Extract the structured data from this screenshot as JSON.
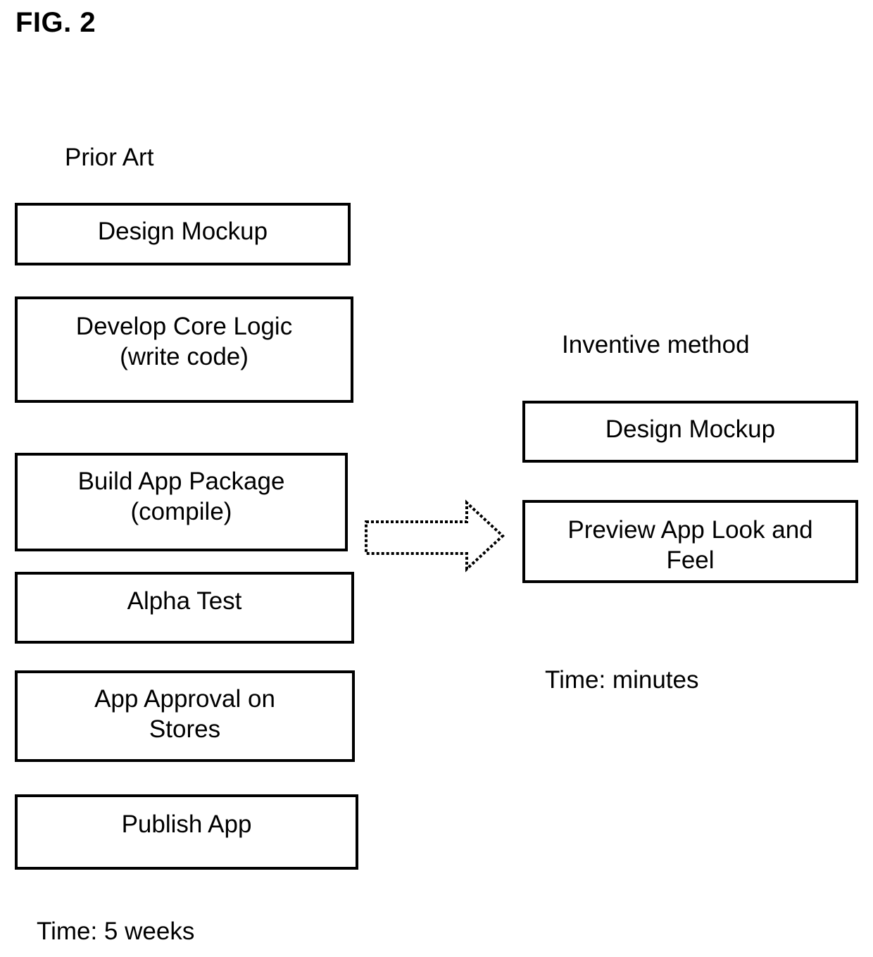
{
  "figure": {
    "number_label": "FIG. 2",
    "line_color": "#000000",
    "background_color": "#ffffff"
  },
  "prior_art": {
    "heading": "Prior Art",
    "steps": [
      {
        "label": "Design Mockup"
      },
      {
        "label": "Develop Core Logic\n(write code)"
      },
      {
        "label": "Build App Package\n(compile)"
      },
      {
        "label": "Alpha Test"
      },
      {
        "label": "App Approval on\nStores"
      },
      {
        "label": "Publish App"
      }
    ],
    "time_caption": "Time: 5 weeks"
  },
  "inventive_method": {
    "heading": "Inventive method",
    "steps": [
      {
        "label": "Design Mockup"
      },
      {
        "label": "Preview App Look and\nFeel"
      }
    ],
    "time_caption": "Time: minutes"
  },
  "transition": {
    "icon": "right-block-arrow-icon"
  }
}
